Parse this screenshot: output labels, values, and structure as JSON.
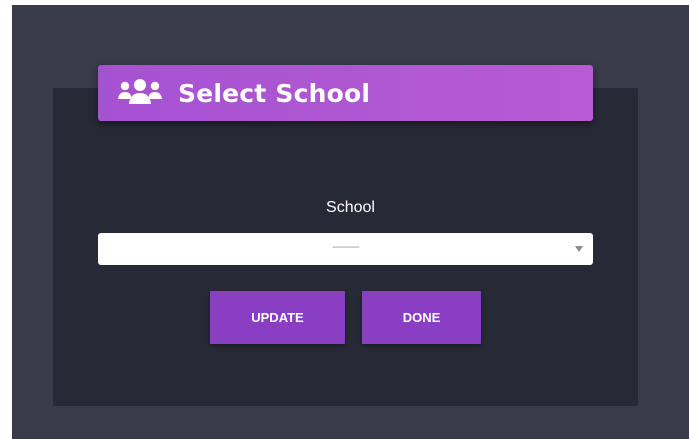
{
  "dialog": {
    "title": "Select School",
    "icon": "users-icon",
    "accent_color": "#b158d3"
  },
  "form": {
    "school_label": "School",
    "school_select_value": "----------"
  },
  "actions": {
    "update_label": "UPDATE",
    "done_label": "DONE",
    "button_color": "#8a3ec4"
  }
}
